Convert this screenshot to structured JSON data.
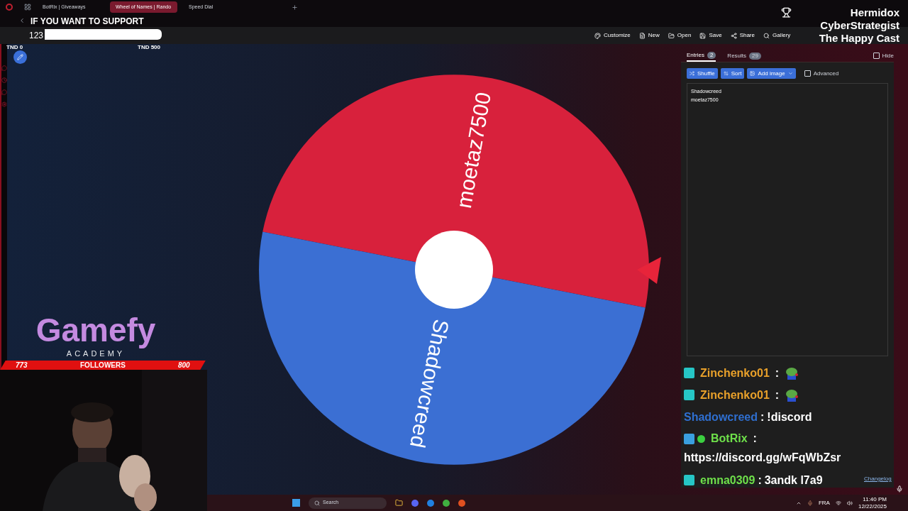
{
  "browser_tabs": [
    {
      "label": "BotRix | Giveaways",
      "selected": false
    },
    {
      "label": "Wheel of Names | Rando",
      "selected": true
    },
    {
      "label": "Speed Dial",
      "selected": false
    }
  ],
  "donation_goal": {
    "title": "IF YOU WANT TO SUPPORT",
    "amount": "123",
    "min": "TND 0",
    "max": "TND 500"
  },
  "toolbar": [
    "Customize",
    "New",
    "Open",
    "Save",
    "Share",
    "Gallery"
  ],
  "wheel": {
    "segments": [
      {
        "label": "moetaz7500",
        "color": "#d8213c"
      },
      {
        "label": "Shadowcreed",
        "color": "#3b6fd3"
      }
    ]
  },
  "panel": {
    "tabs": [
      {
        "label": "Entries",
        "count": "2",
        "selected": true
      },
      {
        "label": "Results",
        "count": "29",
        "selected": false
      }
    ],
    "hide": {
      "label": "Hide",
      "checked": false
    },
    "buttons": [
      "Shuffle",
      "Sort",
      "Add image"
    ],
    "advanced": {
      "label": "Advanced",
      "checked": false
    },
    "entries": [
      "Shadowcreed",
      "moetaz7500"
    ],
    "changelog": "Changelog"
  },
  "logo": {
    "name": "Gamefy",
    "sub": "ACADEMY"
  },
  "followers": {
    "current": "773",
    "label": "FOLLOWERS",
    "goal": "800"
  },
  "credits": [
    "Hermidox",
    "CyberStrategist",
    "The Happy Cast"
  ],
  "chat": [
    {
      "kind": "emote",
      "user": "Zinchenko01",
      "color": "#e8a02a",
      "separator": ":"
    },
    {
      "kind": "emote",
      "user": "Zinchenko01",
      "color": "#e8a02a",
      "separator": ":"
    },
    {
      "kind": "text",
      "user": "Shadowcreed",
      "color": "#2f6fd0",
      "separator": ":",
      "text": "!discord"
    },
    {
      "kind": "link",
      "user": "BotRix",
      "color": "#6ee04a",
      "separator": ":",
      "text": "https://discord.gg/wFqWbZsr"
    },
    {
      "kind": "text",
      "user": "emna0309",
      "color": "#6ee04a",
      "separator": ":",
      "text": "3andk l7a9"
    }
  ],
  "taskbar": {
    "search": "Search",
    "language": "FRA",
    "time": "11:40 PM",
    "date": "12/22/2025"
  }
}
